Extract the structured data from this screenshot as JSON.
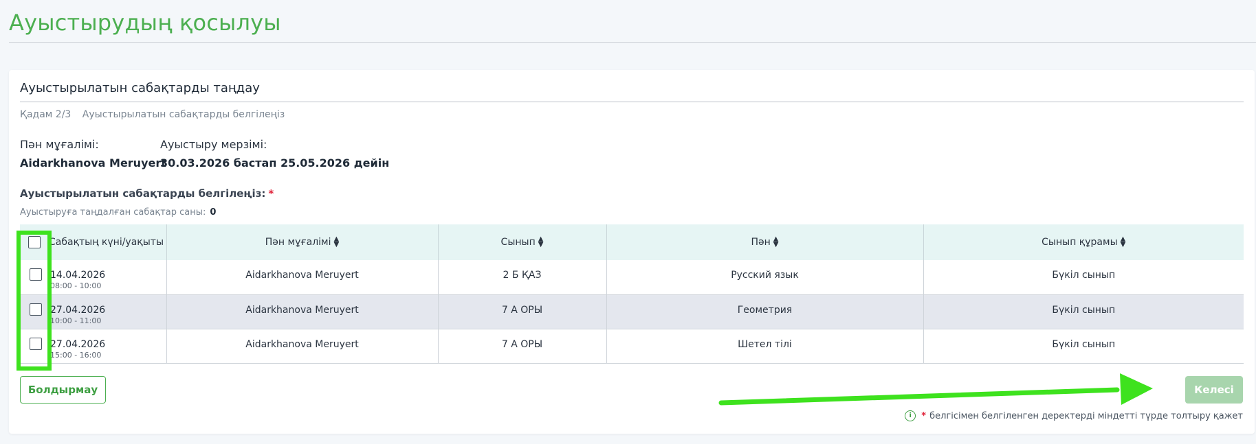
{
  "page": {
    "title": "Ауыстырудың қосылуы"
  },
  "card": {
    "title": "Ауыстырылатын сабақтарды таңдау",
    "step_label": "Қадам 2/3",
    "step_text": "Ауыстырылатын сабақтарды белгілеңіз",
    "teacher_label": "Пән мұғалімі:",
    "teacher_value": "Aidarkhanova Meruyert",
    "period_label": "Ауыстыру мерзімі:",
    "period_value": "30.03.2026 бастап 25.05.2026 дейін",
    "select_label": "Ауыстырылатын сабақтарды белгілеңіз:",
    "required_mark": "*",
    "count_label": "Ауыстыруға таңдалған сабақтар саны:",
    "count_value": "0"
  },
  "table": {
    "headers": [
      "Сабақтың күні/уақыты",
      "Пән мұғалімі",
      "Сынып",
      "Пән",
      "Сынып құрамы"
    ],
    "rows": [
      {
        "date": "14.04.2026",
        "time": "08:00 - 10:00",
        "teacher": "Aidarkhanova Meruyert",
        "class": "2 Б ҚАЗ",
        "subject": "Русский язык",
        "composition": "Бүкіл сынып",
        "checked": false
      },
      {
        "date": "27.04.2026",
        "time": "10:00 - 11:00",
        "teacher": "Aidarkhanova Meruyert",
        "class": "7 А ОРЫ",
        "subject": "Геометрия",
        "composition": "Бүкіл сынып",
        "checked": false
      },
      {
        "date": "27.04.2026",
        "time": "15:00 - 16:00",
        "teacher": "Aidarkhanova Meruyert",
        "class": "7 А ОРЫ",
        "subject": "Шетел тілі",
        "composition": "Бүкіл сынып",
        "checked": false
      }
    ]
  },
  "actions": {
    "cancel_label": "Болдырмау",
    "next_label": "Келесі"
  },
  "footnote": {
    "required_mark": "*",
    "text": "белгісімен белгіленген деректерді міндетті түрде толтыру қажет"
  },
  "colors": {
    "accent": "#4caf50",
    "annotation": "#3ee21e",
    "required": "#e0243b"
  }
}
